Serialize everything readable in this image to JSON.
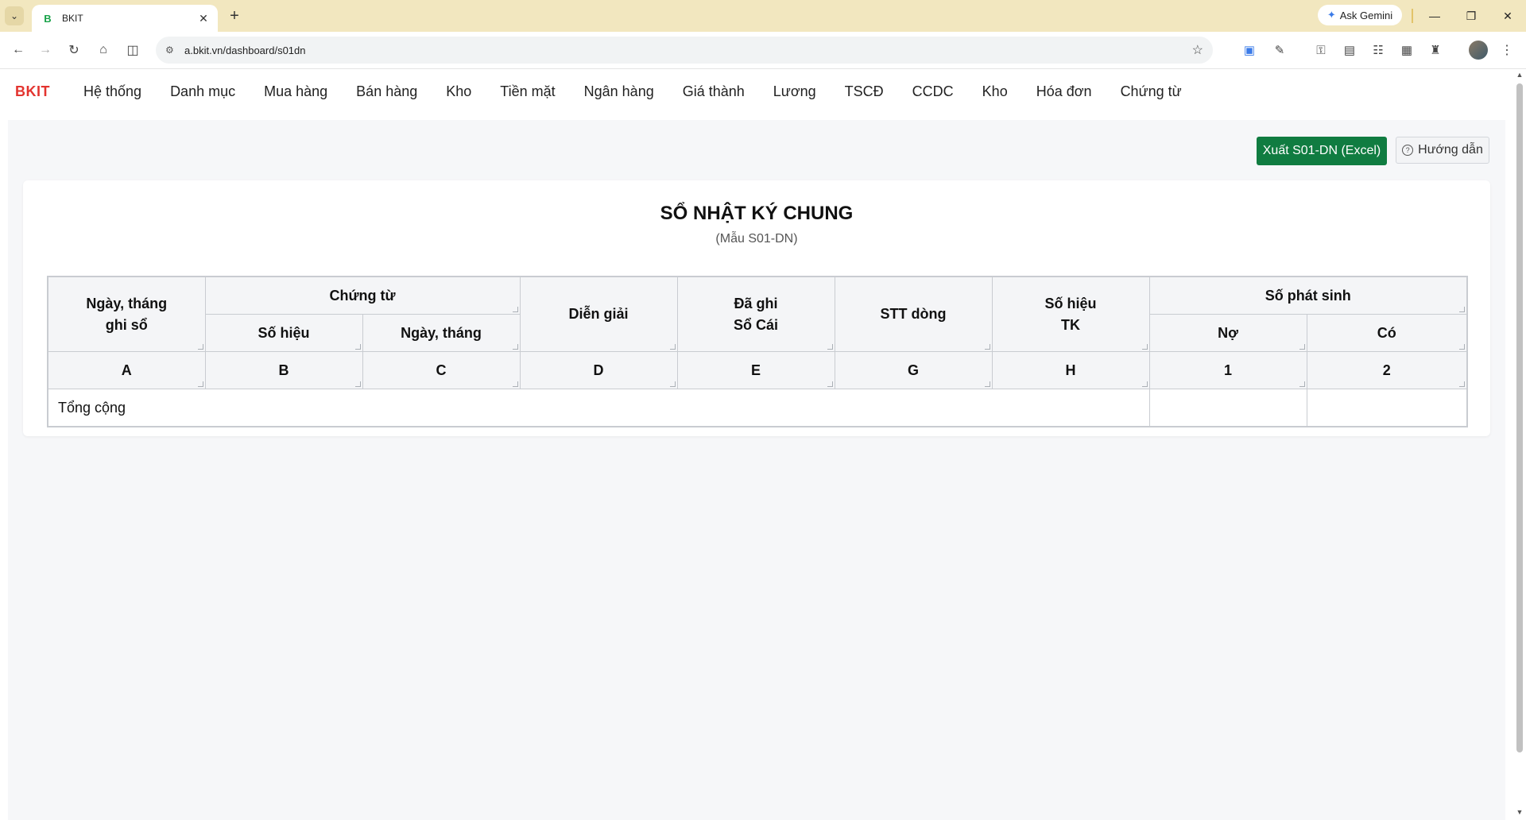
{
  "browser": {
    "tab_title": "BKIT",
    "tab_favicon": "B",
    "url": "a.bkit.vn/dashboard/s01dn",
    "ask_gemini_label": "Ask Gemini"
  },
  "app": {
    "brand": "BKIT",
    "menu": [
      "Hệ thống",
      "Danh mục",
      "Mua hàng",
      "Bán hàng",
      "Kho",
      "Tiền mặt",
      "Ngân hàng",
      "Giá thành",
      "Lương",
      "TSCĐ",
      "CCDC",
      "Kho",
      "Hóa đơn",
      "Chứng từ"
    ]
  },
  "actions": {
    "export_label": "Xuất S01-DN (Excel)",
    "guide_label": "Hướng dẫn",
    "guide_icon": "?"
  },
  "report": {
    "title": "SỔ NHẬT KÝ CHUNG",
    "subtitle": "(Mẫu S01-DN)",
    "headers": {
      "ngay_thang_ghi_so": "Ngày, tháng ghi sổ",
      "chung_tu": "Chứng từ",
      "so_hieu": "Số hiệu",
      "ngay_thang": "Ngày, tháng",
      "dien_giai": "Diễn giải",
      "da_ghi_so_cai": "Đã ghi Sổ Cái",
      "stt_dong": "STT dòng",
      "so_hieu_tk": "Số hiệu TK",
      "so_phat_sinh": "Số phát sinh",
      "no": "Nợ",
      "co": "Có"
    },
    "codes": [
      "A",
      "B",
      "C",
      "D",
      "E",
      "G",
      "H",
      "1",
      "2"
    ],
    "total_label": "Tổng cộng",
    "total_no": "",
    "total_co": ""
  }
}
